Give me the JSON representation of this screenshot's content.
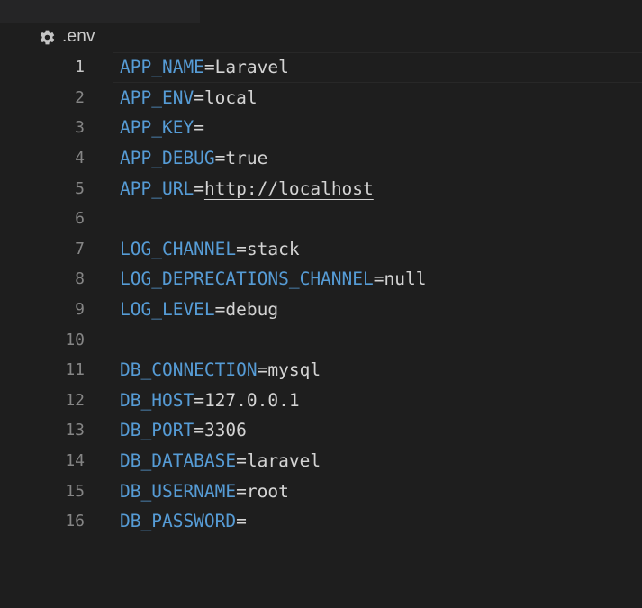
{
  "breadcrumb": {
    "icon": "gear-icon",
    "file": ".env"
  },
  "colors": {
    "background": "#1e1e1e",
    "key": "#569cd6",
    "value": "#d4d4d4",
    "line_number": "#858585",
    "line_number_active": "#c6c6c6"
  },
  "lines": [
    {
      "num": "1",
      "key": "APP_NAME",
      "eq": "=",
      "value": "Laravel"
    },
    {
      "num": "2",
      "key": "APP_ENV",
      "eq": "=",
      "value": "local"
    },
    {
      "num": "3",
      "key": "APP_KEY",
      "eq": "=",
      "value": ""
    },
    {
      "num": "4",
      "key": "APP_DEBUG",
      "eq": "=",
      "value": "true"
    },
    {
      "num": "5",
      "key": "APP_URL",
      "eq": "=",
      "value": "http://localhost"
    },
    {
      "num": "6",
      "key": "",
      "eq": "",
      "value": ""
    },
    {
      "num": "7",
      "key": "LOG_CHANNEL",
      "eq": "=",
      "value": "stack"
    },
    {
      "num": "8",
      "key": "LOG_DEPRECATIONS_CHANNEL",
      "eq": "=",
      "value": "null"
    },
    {
      "num": "9",
      "key": "LOG_LEVEL",
      "eq": "=",
      "value": "debug"
    },
    {
      "num": "10",
      "key": "",
      "eq": "",
      "value": ""
    },
    {
      "num": "11",
      "key": "DB_CONNECTION",
      "eq": "=",
      "value": "mysql"
    },
    {
      "num": "12",
      "key": "DB_HOST",
      "eq": "=",
      "value": "127.0.0.1"
    },
    {
      "num": "13",
      "key": "DB_PORT",
      "eq": "=",
      "value": "3306"
    },
    {
      "num": "14",
      "key": "DB_DATABASE",
      "eq": "=",
      "value": "laravel"
    },
    {
      "num": "15",
      "key": "DB_USERNAME",
      "eq": "=",
      "value": "root"
    },
    {
      "num": "16",
      "key": "DB_PASSWORD",
      "eq": "=",
      "value": ""
    }
  ]
}
